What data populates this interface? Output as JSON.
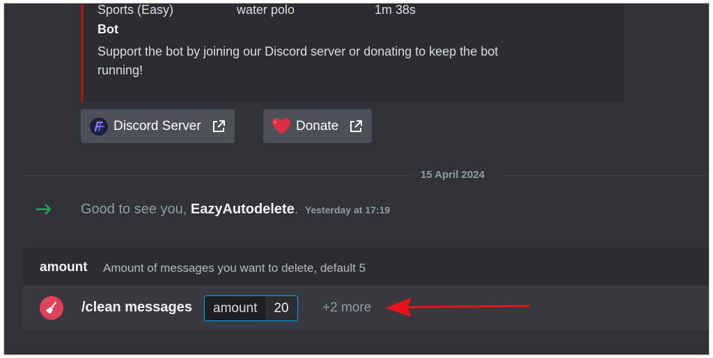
{
  "embed": {
    "row": {
      "category": "Sports (Easy)",
      "word": "water polo",
      "time": "1m 38s"
    },
    "field_title": "Bot",
    "field_text": "Support the bot by joining our Discord server or donating to keep the bot running!"
  },
  "buttons": [
    {
      "label": "Discord Server",
      "icon": "discord-server-logo-icon"
    },
    {
      "label": "Donate",
      "icon": "heart-icon"
    }
  ],
  "date_divider": "15 April 2024",
  "join_message": {
    "prefix": "Good to see you, ",
    "username": "EazyAutodelete",
    "suffix": ".",
    "timestamp": "Yesterday at 17:19"
  },
  "command_autocomplete": {
    "option_name": "amount",
    "option_description": "Amount of messages you want to delete, default 5",
    "command": "/clean messages",
    "option_label": "amount",
    "option_value": "20",
    "more": "+2 more"
  },
  "colors": {
    "background": "#313338",
    "embed_accent": "#a0151b",
    "join_arrow": "#23a55a",
    "app_icon": "#e0425b",
    "annotation_arrow": "#e8141a",
    "focus_border": "#00a8fc"
  }
}
